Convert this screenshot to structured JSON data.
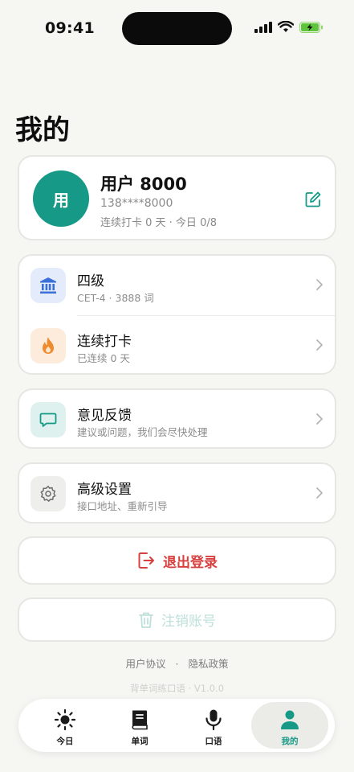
{
  "status_bar": {
    "time": "09:41"
  },
  "page": {
    "title": "我的"
  },
  "profile": {
    "avatar_text": "用",
    "name": "用户 8000",
    "phone": "138****8000",
    "stats": "连续打卡 0 天 · 今日 0/8"
  },
  "list": [
    {
      "title": "四级",
      "subtitle": "CET-4 · 3888 词",
      "icon": "bank-icon"
    },
    {
      "title": "连续打卡",
      "subtitle": "已连续 0 天",
      "icon": "flame-icon"
    }
  ],
  "feedback": {
    "title": "意见反馈",
    "subtitle": "建议或问题，我们会尽快处理",
    "icon": "chat-icon"
  },
  "settings": {
    "title": "高级设置",
    "subtitle": "接口地址、重新引导",
    "icon": "gear-icon"
  },
  "logout": {
    "label": "退出登录",
    "icon": "logout-icon"
  },
  "delete_account": {
    "label": "注销账号",
    "icon": "trash-icon"
  },
  "footer": {
    "user_agreement": "用户协议",
    "separator": "·",
    "privacy_policy": "隐私政策",
    "version": "背单词练口语 · V1.0.0"
  },
  "tabs": [
    {
      "label": "今日",
      "icon": "sun-icon"
    },
    {
      "label": "单词",
      "icon": "book-icon"
    },
    {
      "label": "口语",
      "icon": "microphone-icon"
    },
    {
      "label": "我的",
      "icon": "person-icon",
      "active": true
    }
  ],
  "colors": {
    "accent": "#169a87",
    "danger": "#d84040",
    "background": "#f6f6f3"
  }
}
